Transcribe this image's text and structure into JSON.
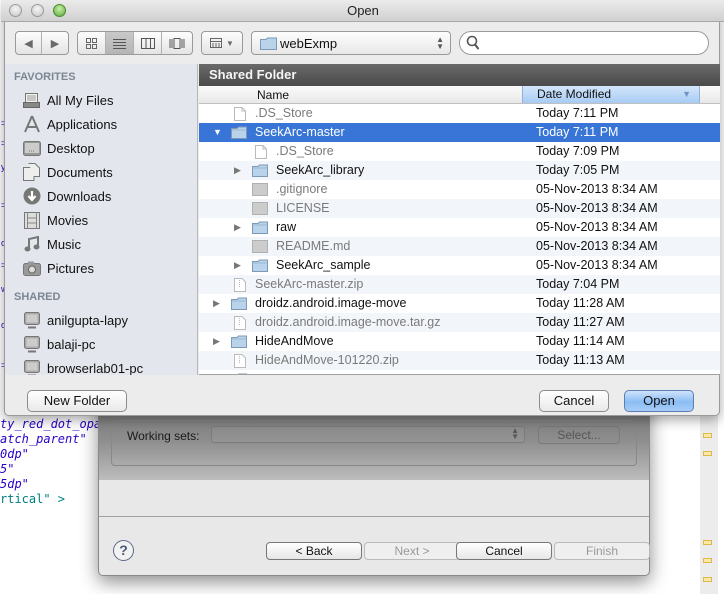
{
  "dialog": {
    "title": "Open",
    "view_modes": [
      "icon-view",
      "list-view",
      "column-view",
      "cover-flow-view"
    ],
    "active_view": "list-view",
    "arrange_menu": "arrange-icon",
    "location": "webExmp",
    "search": {
      "value": "",
      "placeholder": ""
    },
    "path_bar": "Shared Folder",
    "columns": {
      "name": "Name",
      "date": "Date Modified"
    },
    "buttons": {
      "new_folder": "New Folder",
      "cancel": "Cancel",
      "open": "Open"
    }
  },
  "sidebar": {
    "favorites_label": "FAVORITES",
    "favorites": [
      {
        "label": "All My Files",
        "icon": "all-files-icon"
      },
      {
        "label": "Applications",
        "icon": "applications-icon"
      },
      {
        "label": "Desktop",
        "icon": "desktop-icon"
      },
      {
        "label": "Documents",
        "icon": "documents-icon"
      },
      {
        "label": "Downloads",
        "icon": "downloads-icon"
      },
      {
        "label": "Movies",
        "icon": "movies-icon"
      },
      {
        "label": "Music",
        "icon": "music-icon"
      },
      {
        "label": "Pictures",
        "icon": "pictures-icon"
      }
    ],
    "shared_label": "SHARED",
    "shared": [
      {
        "label": "anilgupta-lapy",
        "icon": "computer-icon"
      },
      {
        "label": "balaji-pc",
        "icon": "computer-icon"
      },
      {
        "label": "browserlab01-pc",
        "icon": "computer-icon"
      }
    ]
  },
  "files": [
    {
      "name": ".DS_Store",
      "date": "Today 7:11 PM",
      "type": "file",
      "level": 0,
      "disclosure": "none",
      "dim": true,
      "selected": false
    },
    {
      "name": "SeekArc-master",
      "date": "Today 7:11 PM",
      "type": "folder",
      "level": 0,
      "disclosure": "open",
      "dim": false,
      "selected": true
    },
    {
      "name": ".DS_Store",
      "date": "Today 7:09 PM",
      "type": "file",
      "level": 1,
      "disclosure": "none",
      "dim": true,
      "selected": false
    },
    {
      "name": "SeekArc_library",
      "date": "Today 7:05 PM",
      "type": "folder",
      "level": 1,
      "disclosure": "closed",
      "dim": false,
      "selected": false
    },
    {
      "name": ".gitignore",
      "date": "05-Nov-2013 8:34 AM",
      "type": "doc",
      "level": 1,
      "disclosure": "none",
      "dim": true,
      "selected": false
    },
    {
      "name": "LICENSE",
      "date": "05-Nov-2013 8:34 AM",
      "type": "doc",
      "level": 1,
      "disclosure": "none",
      "dim": true,
      "selected": false
    },
    {
      "name": "raw",
      "date": "05-Nov-2013 8:34 AM",
      "type": "folder",
      "level": 1,
      "disclosure": "closed",
      "dim": false,
      "selected": false
    },
    {
      "name": "README.md",
      "date": "05-Nov-2013 8:34 AM",
      "type": "doc",
      "level": 1,
      "disclosure": "none",
      "dim": true,
      "selected": false
    },
    {
      "name": "SeekArc_sample",
      "date": "05-Nov-2013 8:34 AM",
      "type": "folder",
      "level": 1,
      "disclosure": "closed",
      "dim": false,
      "selected": false
    },
    {
      "name": "SeekArc-master.zip",
      "date": "Today 7:04 PM",
      "type": "archive",
      "level": 0,
      "disclosure": "none",
      "dim": true,
      "selected": false
    },
    {
      "name": "droidz.android.image-move",
      "date": "Today 11:28 AM",
      "type": "folder",
      "level": 0,
      "disclosure": "closed",
      "dim": false,
      "selected": false
    },
    {
      "name": "droidz.android.image-move.tar.gz",
      "date": "Today 11:27 AM",
      "type": "archive",
      "level": 0,
      "disclosure": "none",
      "dim": true,
      "selected": false
    },
    {
      "name": "HideAndMove",
      "date": "Today 11:14 AM",
      "type": "folder",
      "level": 0,
      "disclosure": "closed",
      "dim": false,
      "selected": false
    },
    {
      "name": "HideAndMove-101220.zip",
      "date": "Today 11:13 AM",
      "type": "archive",
      "level": 0,
      "disclosure": "none",
      "dim": true,
      "selected": false
    }
  ],
  "wizard": {
    "working_sets_label": "Working sets:",
    "select_button": "Select...",
    "back": "< Back",
    "next": "Next >",
    "cancel": "Cancel",
    "finish": "Finish"
  },
  "editor": {
    "code_lines": [
      "ty_red_dot_opac",
      "atch_parent\"",
      "0dp\"",
      "5\"",
      "5dp\"",
      "rtical\" >"
    ]
  }
}
